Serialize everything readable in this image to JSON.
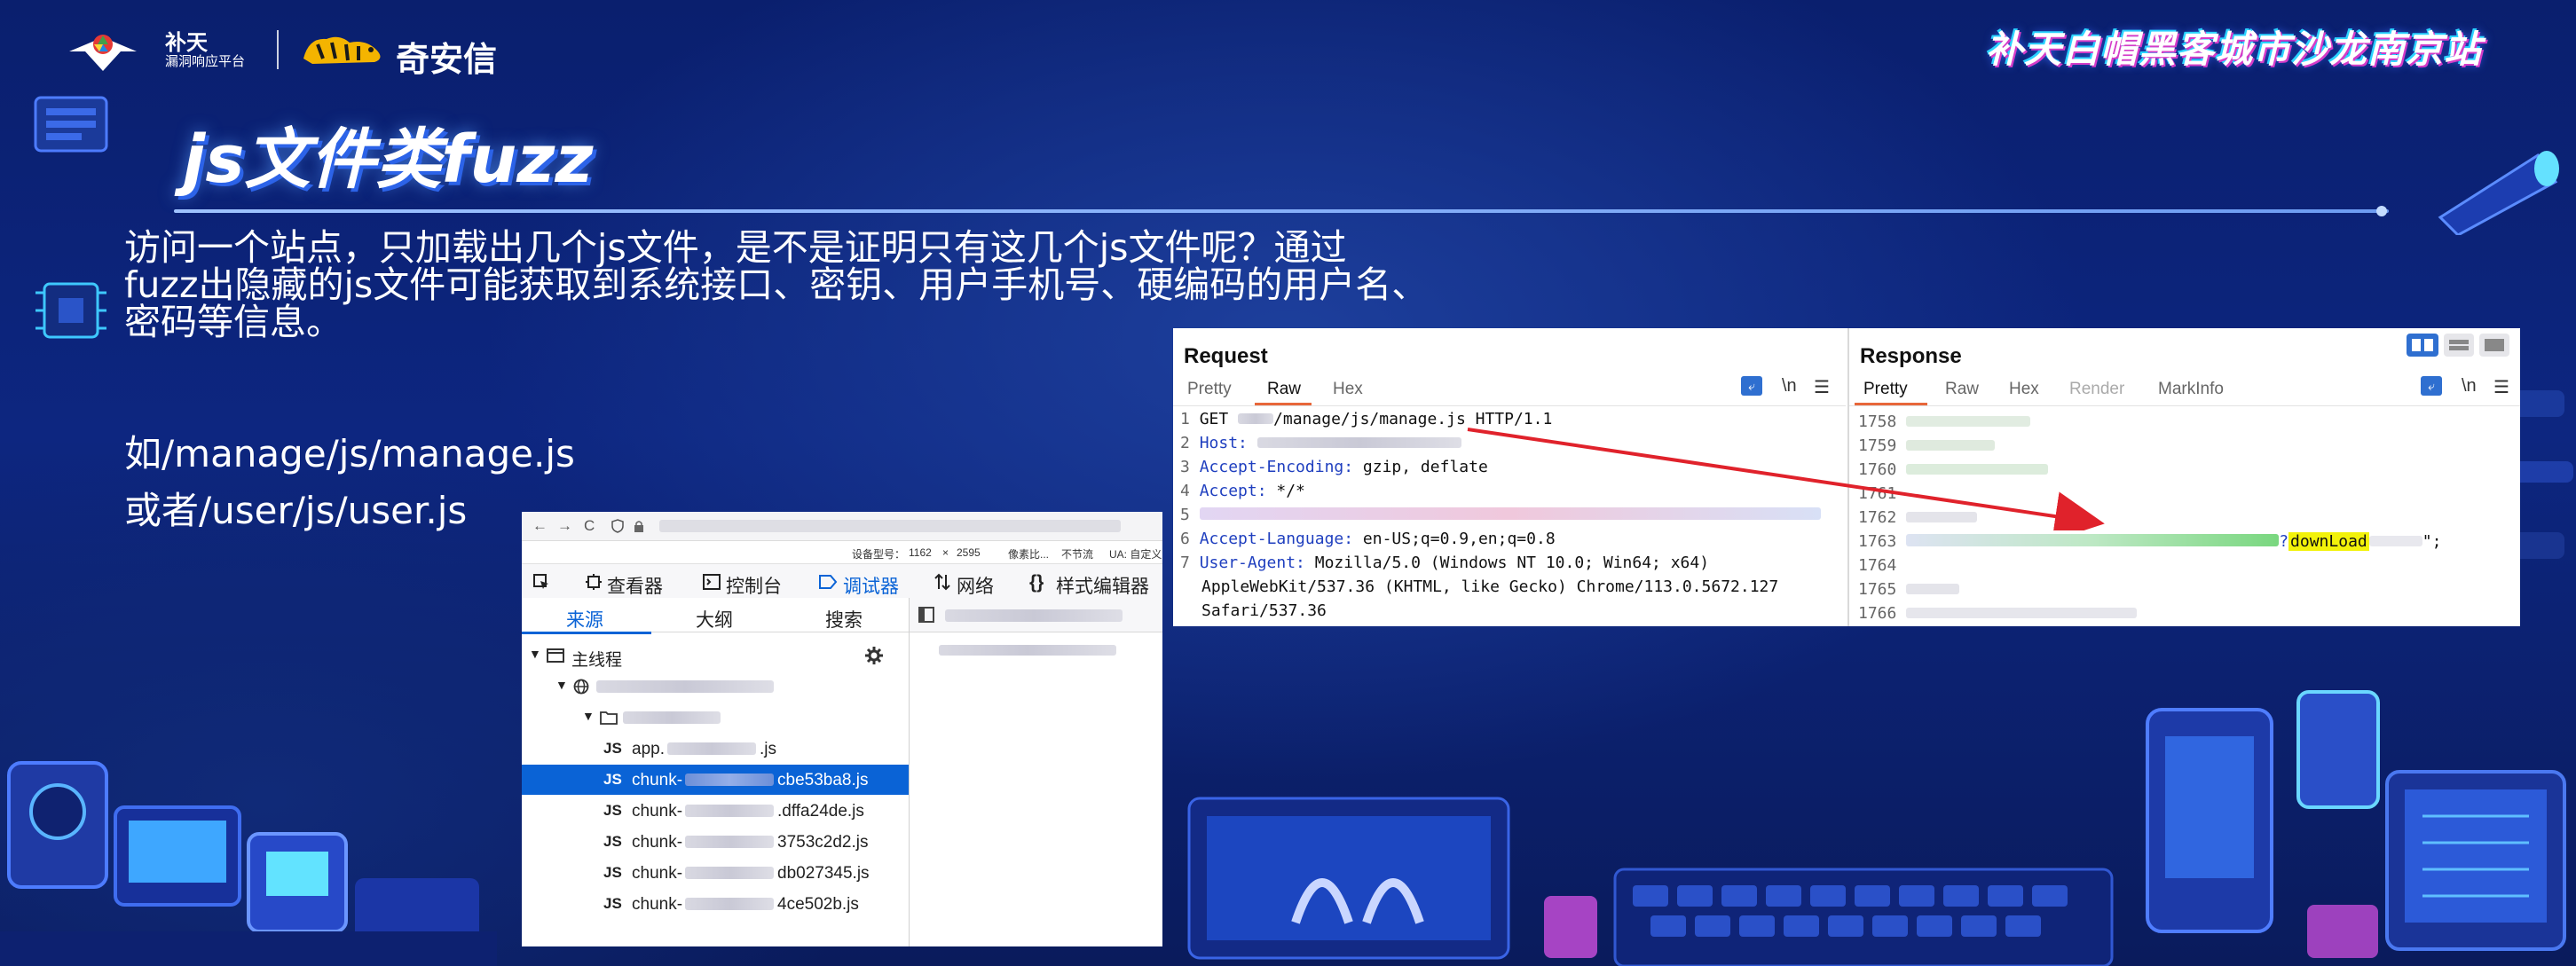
{
  "header": {
    "butian_logo_top": "补天",
    "butian_logo_bottom": "漏洞响应平台",
    "qax_logo_text": "奇安信",
    "event_title": "补天白帽黑客城市沙龙南京站"
  },
  "slide": {
    "title": "js文件类fuzz",
    "description_lines": [
      "访问一个站点，只加载出几个js文件，是不是证明只有这几个js文件呢？通过",
      "fuzz出隐藏的js文件可能获取到系统接口、密钥、用户手机号、硬编码的用户名、",
      "密码等信息。"
    ],
    "examples": [
      "如/manage/js/manage.js",
      "或者/user/js/user.js"
    ]
  },
  "devtools": {
    "nav": [
      "←",
      "→",
      "C"
    ],
    "device_bar": [
      "设备型号：",
      "1162",
      "×",
      "2595",
      "像素比...",
      "不节流",
      "UA: 自定义"
    ],
    "tabs": [
      "查看器",
      "控制台",
      "调试器",
      "网络",
      "样式编辑器"
    ],
    "active_tab": "调试器",
    "subtabs": [
      "来源",
      "大纲",
      "搜索"
    ],
    "active_subtab": "来源",
    "main_thread": "主线程",
    "file_tag": "JS",
    "files": [
      {
        "prefix": "app.",
        "suffix": ".js",
        "selected": false
      },
      {
        "prefix": "chunk-",
        "suffix": "cbe53ba8.js",
        "selected": true
      },
      {
        "prefix": "chunk-",
        "suffix": ".dffa24de.js",
        "selected": false
      },
      {
        "prefix": "chunk-",
        "suffix": "3753c2d2.js",
        "selected": false
      },
      {
        "prefix": "chunk-",
        "suffix": "db027345.js",
        "selected": false
      },
      {
        "prefix": "chunk-",
        "suffix": "4ce502b.js",
        "selected": false
      }
    ]
  },
  "burp": {
    "request": {
      "title": "Request",
      "tabs": [
        "Pretty",
        "Raw",
        "Hex"
      ],
      "active_tab": "Raw",
      "newline_label": "\\n",
      "lines": [
        {
          "n": "1",
          "text": "GET ",
          "rest": "/manage/js/manage.js HTTP/1.1"
        },
        {
          "n": "2",
          "key": "Host:",
          "value": ""
        },
        {
          "n": "3",
          "key": "Accept-Encoding:",
          "value": " gzip, deflate"
        },
        {
          "n": "4",
          "key": "Accept:",
          "value": " */*"
        },
        {
          "n": "5",
          "key": "",
          "value": ""
        },
        {
          "n": "6",
          "key": "Accept-Language:",
          "value": " en-US;q=0.9,en;q=0.8"
        },
        {
          "n": "7",
          "key": "User-Agent:",
          "value": " Mozilla/5.0 (Windows NT 10.0; Win64; x64)"
        },
        {
          "n": "",
          "key": "",
          "value": "AppleWebKit/537.36 (KHTML, like Gecko) Chrome/113.0.5672.127"
        },
        {
          "n": "",
          "key": "",
          "value": "Safari/537.36"
        }
      ]
    },
    "response": {
      "title": "Response",
      "tabs": [
        "Pretty",
        "Raw",
        "Hex",
        "Render",
        "MarkInfo"
      ],
      "active_tab": "Pretty",
      "newline_label": "\\n",
      "line_numbers": [
        "1758",
        "1759",
        "1760",
        "1761",
        "1762",
        "1763",
        "1764",
        "1765",
        "1766"
      ],
      "highlight_prefix": "?",
      "highlight": "downLoad",
      "line_suffix": "\";"
    }
  },
  "colors": {
    "accent_blue": "#0a63d6",
    "burp_orange": "#e8673a",
    "arrow_red": "#e0222b",
    "highlight_yellow": "#f2f20a"
  }
}
